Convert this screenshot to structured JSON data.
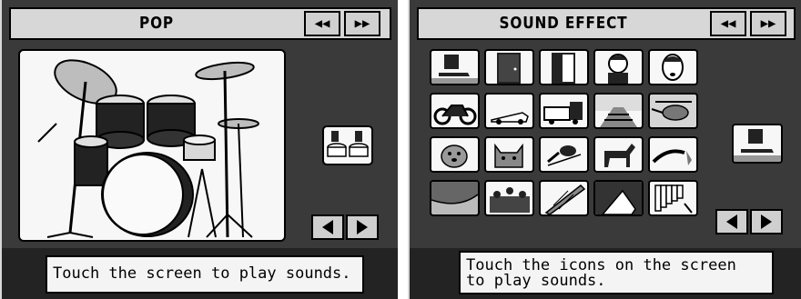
{
  "left_screen": {
    "title": "POP",
    "prev_icon": "double-left-arrow-icon",
    "next_icon": "double-right-arrow-icon",
    "illustration": "drum-kit",
    "side_icon": "drummer-hands-icon",
    "message": "Touch the screen to play sounds."
  },
  "right_screen": {
    "title": "SOUND EFFECT",
    "prev_icon": "double-left-arrow-icon",
    "next_icon": "double-right-arrow-icon",
    "effects": [
      {
        "name": "footstep"
      },
      {
        "name": "door-close"
      },
      {
        "name": "door-open"
      },
      {
        "name": "girl-laugh"
      },
      {
        "name": "man-scream"
      },
      {
        "name": "motorcycle"
      },
      {
        "name": "racing-car"
      },
      {
        "name": "truck"
      },
      {
        "name": "railroad"
      },
      {
        "name": "helicopter"
      },
      {
        "name": "dog"
      },
      {
        "name": "cat"
      },
      {
        "name": "bird"
      },
      {
        "name": "horse"
      },
      {
        "name": "fire-hose"
      },
      {
        "name": "seashore"
      },
      {
        "name": "applause"
      },
      {
        "name": "harp"
      },
      {
        "name": "cello-player"
      },
      {
        "name": "pan-flute"
      }
    ],
    "selected_icon": "footstep",
    "message": "Touch the icons on the screen\nto play sounds."
  }
}
